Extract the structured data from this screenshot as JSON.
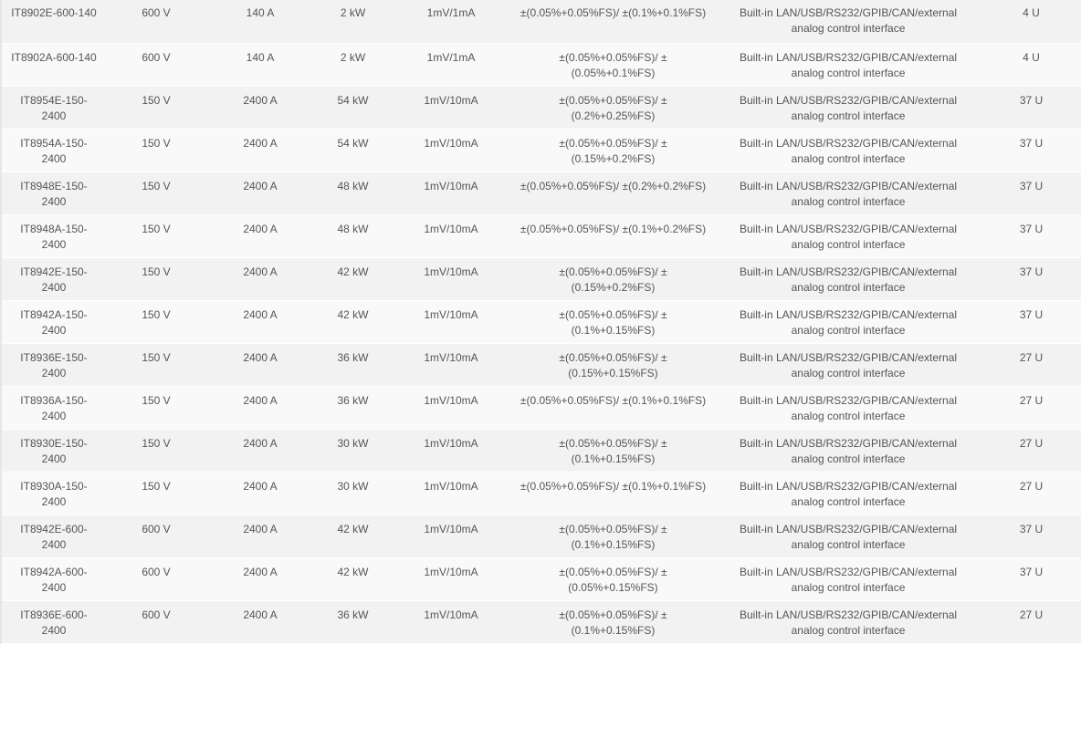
{
  "spec_table": {
    "rows": [
      {
        "model": "IT8902E-600-140",
        "voltage": "600 V",
        "current": "140 A",
        "power": "2 kW",
        "resolution": "1mV/1mA",
        "accuracy": "±(0.05%+0.05%FS)/ ±(0.1%+0.1%FS)",
        "interface": "Built-in LAN/USB/RS232/GPIB/CAN/external analog control interface",
        "size": "4 U"
      },
      {
        "model": "IT8902A-600-140",
        "voltage": "600 V",
        "current": "140 A",
        "power": "2 kW",
        "resolution": "1mV/1mA",
        "accuracy": "±(0.05%+0.05%FS)/ ±(0.05%+0.1%FS)",
        "interface": "Built-in LAN/USB/RS232/GPIB/CAN/external analog control interface",
        "size": "4 U"
      },
      {
        "model": "IT8954E-150-2400",
        "voltage": "150 V",
        "current": "2400 A",
        "power": "54 kW",
        "resolution": "1mV/10mA",
        "accuracy": "±(0.05%+0.05%FS)/ ±(0.2%+0.25%FS)",
        "interface": "Built-in LAN/USB/RS232/GPIB/CAN/external analog control interface",
        "size": "37 U"
      },
      {
        "model": "IT8954A-150-2400",
        "voltage": "150 V",
        "current": "2400 A",
        "power": "54 kW",
        "resolution": "1mV/10mA",
        "accuracy": "±(0.05%+0.05%FS)/ ±(0.15%+0.2%FS)",
        "interface": "Built-in LAN/USB/RS232/GPIB/CAN/external analog control interface",
        "size": "37 U"
      },
      {
        "model": "IT8948E-150-2400",
        "voltage": "150 V",
        "current": "2400 A",
        "power": "48 kW",
        "resolution": "1mV/10mA",
        "accuracy": "±(0.05%+0.05%FS)/ ±(0.2%+0.2%FS)",
        "interface": "Built-in LAN/USB/RS232/GPIB/CAN/external analog control interface",
        "size": "37 U"
      },
      {
        "model": "IT8948A-150-2400",
        "voltage": "150 V",
        "current": "2400 A",
        "power": "48 kW",
        "resolution": "1mV/10mA",
        "accuracy": "±(0.05%+0.05%FS)/ ±(0.1%+0.2%FS)",
        "interface": "Built-in LAN/USB/RS232/GPIB/CAN/external analog control interface",
        "size": "37 U"
      },
      {
        "model": "IT8942E-150-2400",
        "voltage": "150 V",
        "current": "2400 A",
        "power": "42 kW",
        "resolution": "1mV/10mA",
        "accuracy": "±(0.05%+0.05%FS)/ ±(0.15%+0.2%FS)",
        "interface": "Built-in LAN/USB/RS232/GPIB/CAN/external analog control interface",
        "size": "37 U"
      },
      {
        "model": "IT8942A-150-2400",
        "voltage": "150 V",
        "current": "2400 A",
        "power": "42 kW",
        "resolution": "1mV/10mA",
        "accuracy": "±(0.05%+0.05%FS)/ ±(0.1%+0.15%FS)",
        "interface": "Built-in LAN/USB/RS232/GPIB/CAN/external analog control interface",
        "size": "37 U"
      },
      {
        "model": "IT8936E-150-2400",
        "voltage": "150 V",
        "current": "2400 A",
        "power": "36 kW",
        "resolution": "1mV/10mA",
        "accuracy": "±(0.05%+0.05%FS)/ ±(0.15%+0.15%FS)",
        "interface": "Built-in LAN/USB/RS232/GPIB/CAN/external analog control interface",
        "size": "27 U"
      },
      {
        "model": "IT8936A-150-2400",
        "voltage": "150 V",
        "current": "2400 A",
        "power": "36 kW",
        "resolution": "1mV/10mA",
        "accuracy": "±(0.05%+0.05%FS)/ ±(0.1%+0.1%FS)",
        "interface": "Built-in LAN/USB/RS232/GPIB/CAN/external analog control interface",
        "size": "27 U"
      },
      {
        "model": "IT8930E-150-2400",
        "voltage": "150 V",
        "current": "2400 A",
        "power": "30 kW",
        "resolution": "1mV/10mA",
        "accuracy": "±(0.05%+0.05%FS)/ ±(0.1%+0.15%FS)",
        "interface": "Built-in LAN/USB/RS232/GPIB/CAN/external analog control interface",
        "size": "27 U"
      },
      {
        "model": "IT8930A-150-2400",
        "voltage": "150 V",
        "current": "2400 A",
        "power": "30 kW",
        "resolution": "1mV/10mA",
        "accuracy": "±(0.05%+0.05%FS)/ ±(0.1%+0.1%FS)",
        "interface": "Built-in LAN/USB/RS232/GPIB/CAN/external analog control interface",
        "size": "27 U"
      },
      {
        "model": "IT8942E-600-2400",
        "voltage": "600 V",
        "current": "2400 A",
        "power": "42 kW",
        "resolution": "1mV/10mA",
        "accuracy": "±(0.05%+0.05%FS)/ ±(0.1%+0.15%FS)",
        "interface": "Built-in LAN/USB/RS232/GPIB/CAN/external analog control interface",
        "size": "37 U"
      },
      {
        "model": "IT8942A-600-2400",
        "voltage": "600 V",
        "current": "2400 A",
        "power": "42 kW",
        "resolution": "1mV/10mA",
        "accuracy": "±(0.05%+0.05%FS)/ ±(0.05%+0.15%FS)",
        "interface": "Built-in LAN/USB/RS232/GPIB/CAN/external analog control interface",
        "size": "37 U"
      },
      {
        "model": "IT8936E-600-2400",
        "voltage": "600 V",
        "current": "2400 A",
        "power": "36 kW",
        "resolution": "1mV/10mA",
        "accuracy": "±(0.05%+0.05%FS)/ ±(0.1%+0.15%FS)",
        "interface": "Built-in LAN/USB/RS232/GPIB/CAN/external analog control interface",
        "size": "27 U"
      }
    ]
  }
}
